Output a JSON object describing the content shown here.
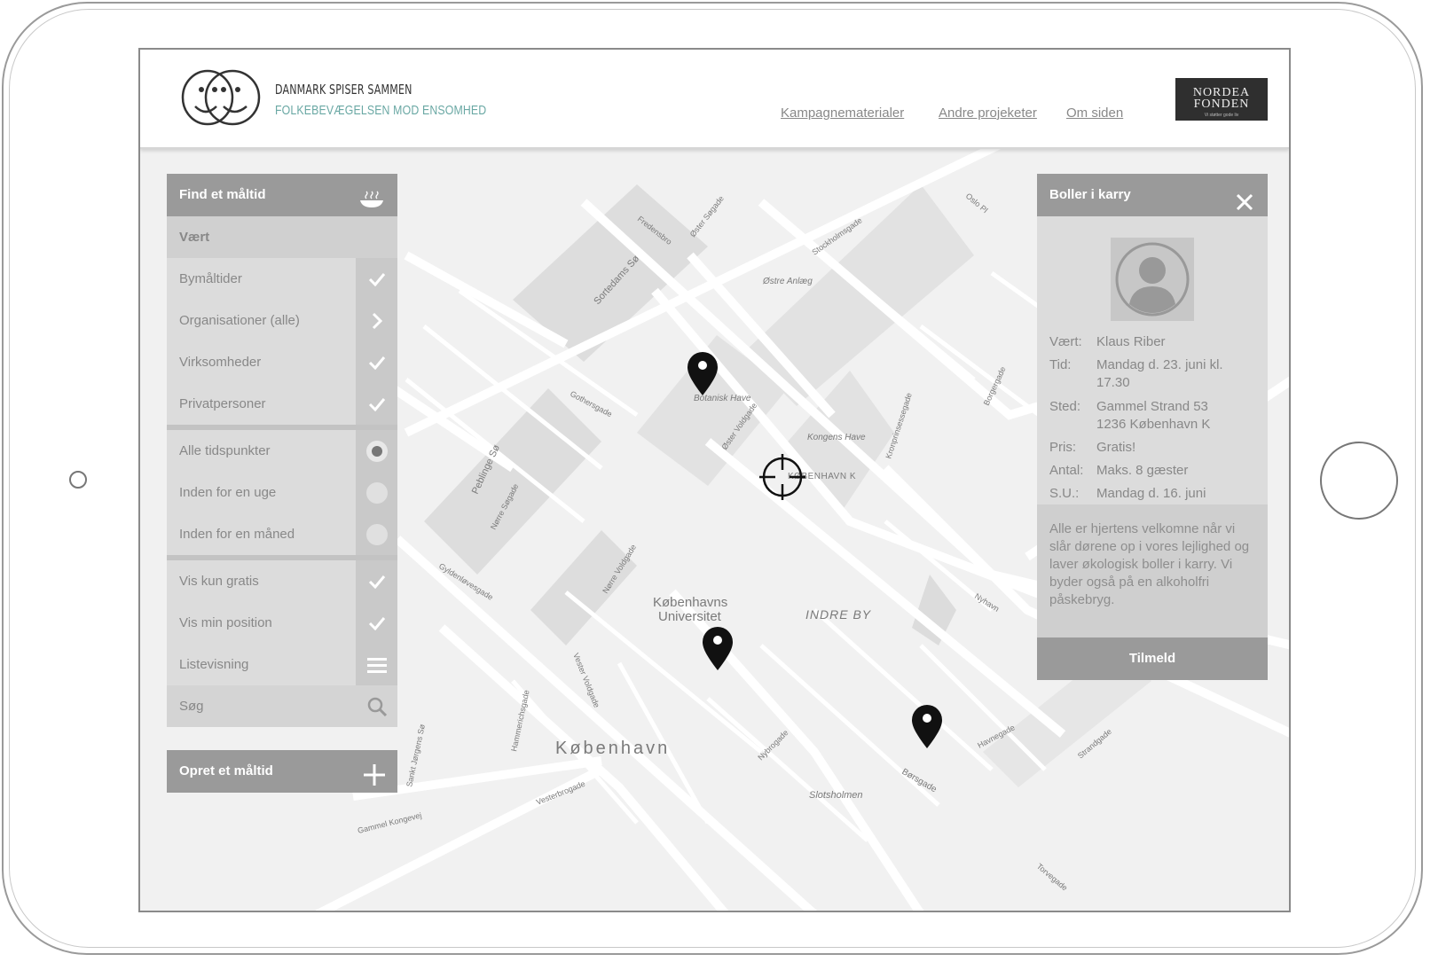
{
  "header": {
    "brand_title": "DANMARK SPISER SAMMEN",
    "brand_subtitle": "FOLKEBEVÆGELSEN MOD ENSOMHED",
    "nav": [
      "Kampagnematerialer",
      "Andre projeketer",
      "Om siden"
    ],
    "sponsor_line1": "NORDEA",
    "sponsor_line2": "FONDEN",
    "sponsor_tagline": "Vi støtter gode liv"
  },
  "find_panel": {
    "title": "Find et måltid",
    "section_host": "Vært",
    "host_filters": [
      {
        "label": "Bymåltider",
        "icon": "check-icon"
      },
      {
        "label": "Organisationer (alle)",
        "icon": "chevron-right-icon"
      },
      {
        "label": "Virksomheder",
        "icon": "check-icon"
      },
      {
        "label": "Privatpersoner",
        "icon": "check-icon"
      }
    ],
    "time_filters": [
      {
        "label": "Alle tidspunkter",
        "selected": true
      },
      {
        "label": "Inden for en uge",
        "selected": false
      },
      {
        "label": "Inden for en måned",
        "selected": false
      }
    ],
    "options": [
      {
        "label": "Vis kun gratis",
        "icon": "check-icon"
      },
      {
        "label": "Vis min position",
        "icon": "check-icon"
      },
      {
        "label": "Listevisning",
        "icon": "list-icon"
      }
    ],
    "search_placeholder": "Søg",
    "create_label": "Opret et måltid"
  },
  "detail_panel": {
    "title": "Boller i karry",
    "fields": [
      {
        "key": "Vært:",
        "value": "Klaus Riber"
      },
      {
        "key": "Tid:",
        "value": "Mandag d. 23. juni kl. 17.30"
      },
      {
        "key": "Sted:",
        "value": "Gammel Strand 53 1236 København K"
      },
      {
        "key": "Pris:",
        "value": "Gratis!"
      },
      {
        "key": "Antal:",
        "value": "Maks. 8 gæster"
      },
      {
        "key": "S.U.:",
        "value": "Mandag d. 16. juni"
      }
    ],
    "description": "Alle er hjertens velkomne når vi slår dørene op i vores lejlighed og laver økologisk boller i karry. Vi byder også på en alkoholfri påskebryg.",
    "signup_label": "Tilmeld"
  },
  "map": {
    "labels": {
      "city": "København",
      "university": "Københavns Universitet",
      "inner_city": "INDRE BY",
      "district": "KØBENHAVN K",
      "botanic": "Botanisk Have",
      "kings_garden": "Kongens Have",
      "slotsholmen": "Slotsholmen",
      "sortedams": "Sortedams Sø",
      "peblinge": "Peblinge Sø",
      "borsgade": "Børsgade",
      "ostre_anlaeg": "Østre Anlæg",
      "gothersgade": "Gothersgade",
      "oster_voldgade": "Øster Voldgade",
      "norre_sogade": "Nørre Søgade",
      "vesterbrogade": "Vesterbrogade",
      "gammel_kongevej": "Gammel Kongevej",
      "fredensbro": "Fredensbro",
      "oster_sogade": "Øster Søgade",
      "hammerichsgade": "Hammerichsgade",
      "norre_voldgade": "Nørre Voldgade",
      "gyldenloevesgade": "Gyldenløvesgade",
      "nyhavn": "Nyhavn",
      "havnegade": "Havnegade",
      "strandgade": "Strandgade",
      "vester_voldgade": "Vester Voldgade",
      "sankt_jorgens": "Sankt Jørgens Sø",
      "oslo_pl": "Oslo Pl",
      "stockholmsgade": "Stockholmsgade",
      "kronprinsessegade": "Kronprinsessegade",
      "bredgade": "Borgergade",
      "nybrogade": "Nybrogade",
      "torvegade": "Torvegade"
    }
  }
}
